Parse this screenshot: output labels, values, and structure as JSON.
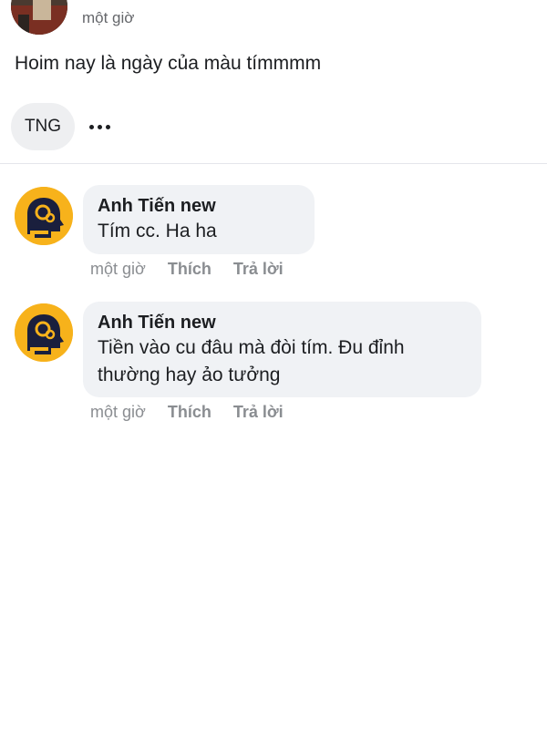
{
  "post": {
    "time": "một giờ",
    "text": "Hoim nay là ngày của màu tímmmm",
    "tag_chip": "TNG",
    "more_icon": "more-horizontal-icon"
  },
  "comments": [
    {
      "author": "Anh Tiến new",
      "text": "Tím cc. Ha ha",
      "time": "một giờ",
      "like_label": "Thích",
      "reply_label": "Trả lời"
    },
    {
      "author": "Anh Tiến new",
      "text": "Tiền vào cu đâu mà đòi tím. Đu đỉnh thường hay ảo tưởng",
      "time": "một giờ",
      "like_label": "Thích",
      "reply_label": "Trả lời"
    }
  ],
  "colors": {
    "bubble_bg": "#f0f2f5",
    "meta_text": "#8a8d91",
    "avatar_yellow": "#f7b21b"
  }
}
